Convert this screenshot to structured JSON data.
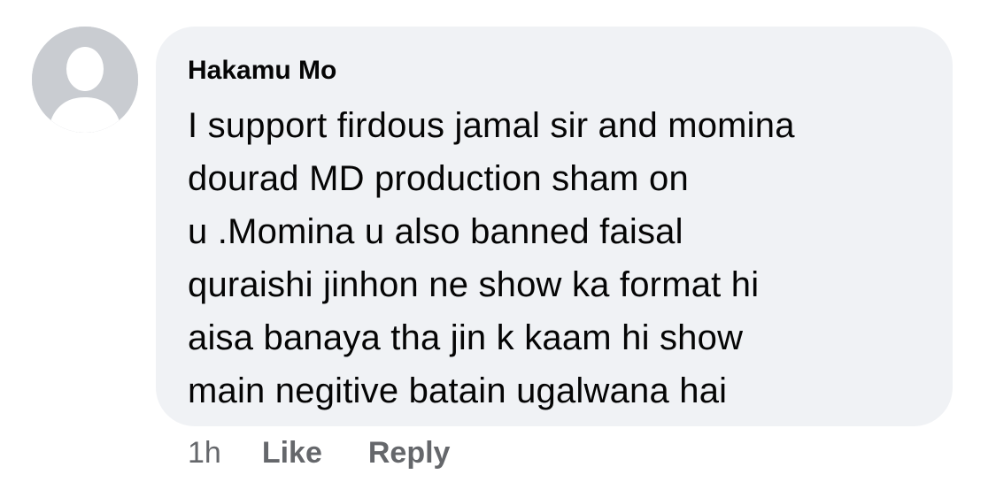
{
  "comment": {
    "author": "Hakamu Mo",
    "text": "I support firdous jamal sir and momina\ndourad MD production sham on\nu .Momina u also banned faisal\nquraishi jinhon ne  show ka format hi\naisa banaya tha jin k kaam hi show\nmain negitive batain ugalwana hai",
    "avatar_icon": "default-profile-silhouette-icon"
  },
  "actions": {
    "timestamp": "1h",
    "like_label": "Like",
    "reply_label": "Reply"
  },
  "colors": {
    "bubble_bg": "#f0f2f5",
    "avatar_bg": "#c9ccd1",
    "secondary_text": "#65676b"
  }
}
